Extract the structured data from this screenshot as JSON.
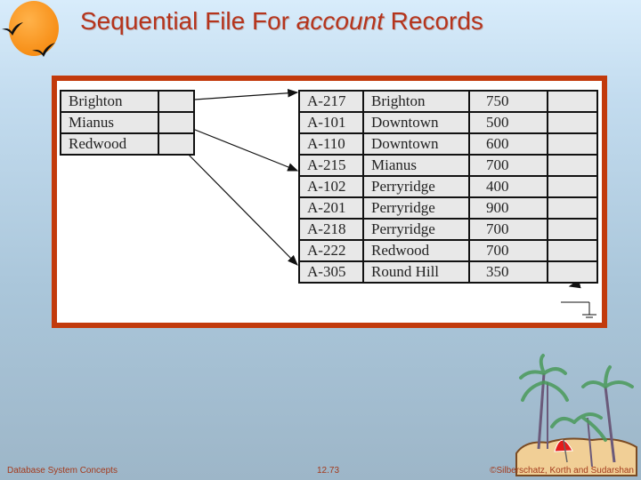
{
  "slide": {
    "title_prefix": "Sequential File For ",
    "title_italic": "account",
    "title_suffix": " Records"
  },
  "index_table": {
    "rows": [
      {
        "name": "Brighton"
      },
      {
        "name": "Mianus"
      },
      {
        "name": "Redwood"
      }
    ]
  },
  "account_table": {
    "rows": [
      {
        "id": "A-217",
        "branch": "Brighton",
        "balance": "750"
      },
      {
        "id": "A-101",
        "branch": "Downtown",
        "balance": "500"
      },
      {
        "id": "A-110",
        "branch": "Downtown",
        "balance": "600"
      },
      {
        "id": "A-215",
        "branch": "Mianus",
        "balance": "700"
      },
      {
        "id": "A-102",
        "branch": "Perryridge",
        "balance": "400"
      },
      {
        "id": "A-201",
        "branch": "Perryridge",
        "balance": "900"
      },
      {
        "id": "A-218",
        "branch": "Perryridge",
        "balance": "700"
      },
      {
        "id": "A-222",
        "branch": "Redwood",
        "balance": "700"
      },
      {
        "id": "A-305",
        "branch": "Round Hill",
        "balance": "350"
      }
    ]
  },
  "footer": {
    "left": "Database System Concepts",
    "center": "12.73",
    "right": "©Silberschatz, Korth and Sudarshan"
  },
  "colors": {
    "title": "#b5341c",
    "frame": "#c23a0c",
    "cell_bg": "#e8e8e8"
  }
}
